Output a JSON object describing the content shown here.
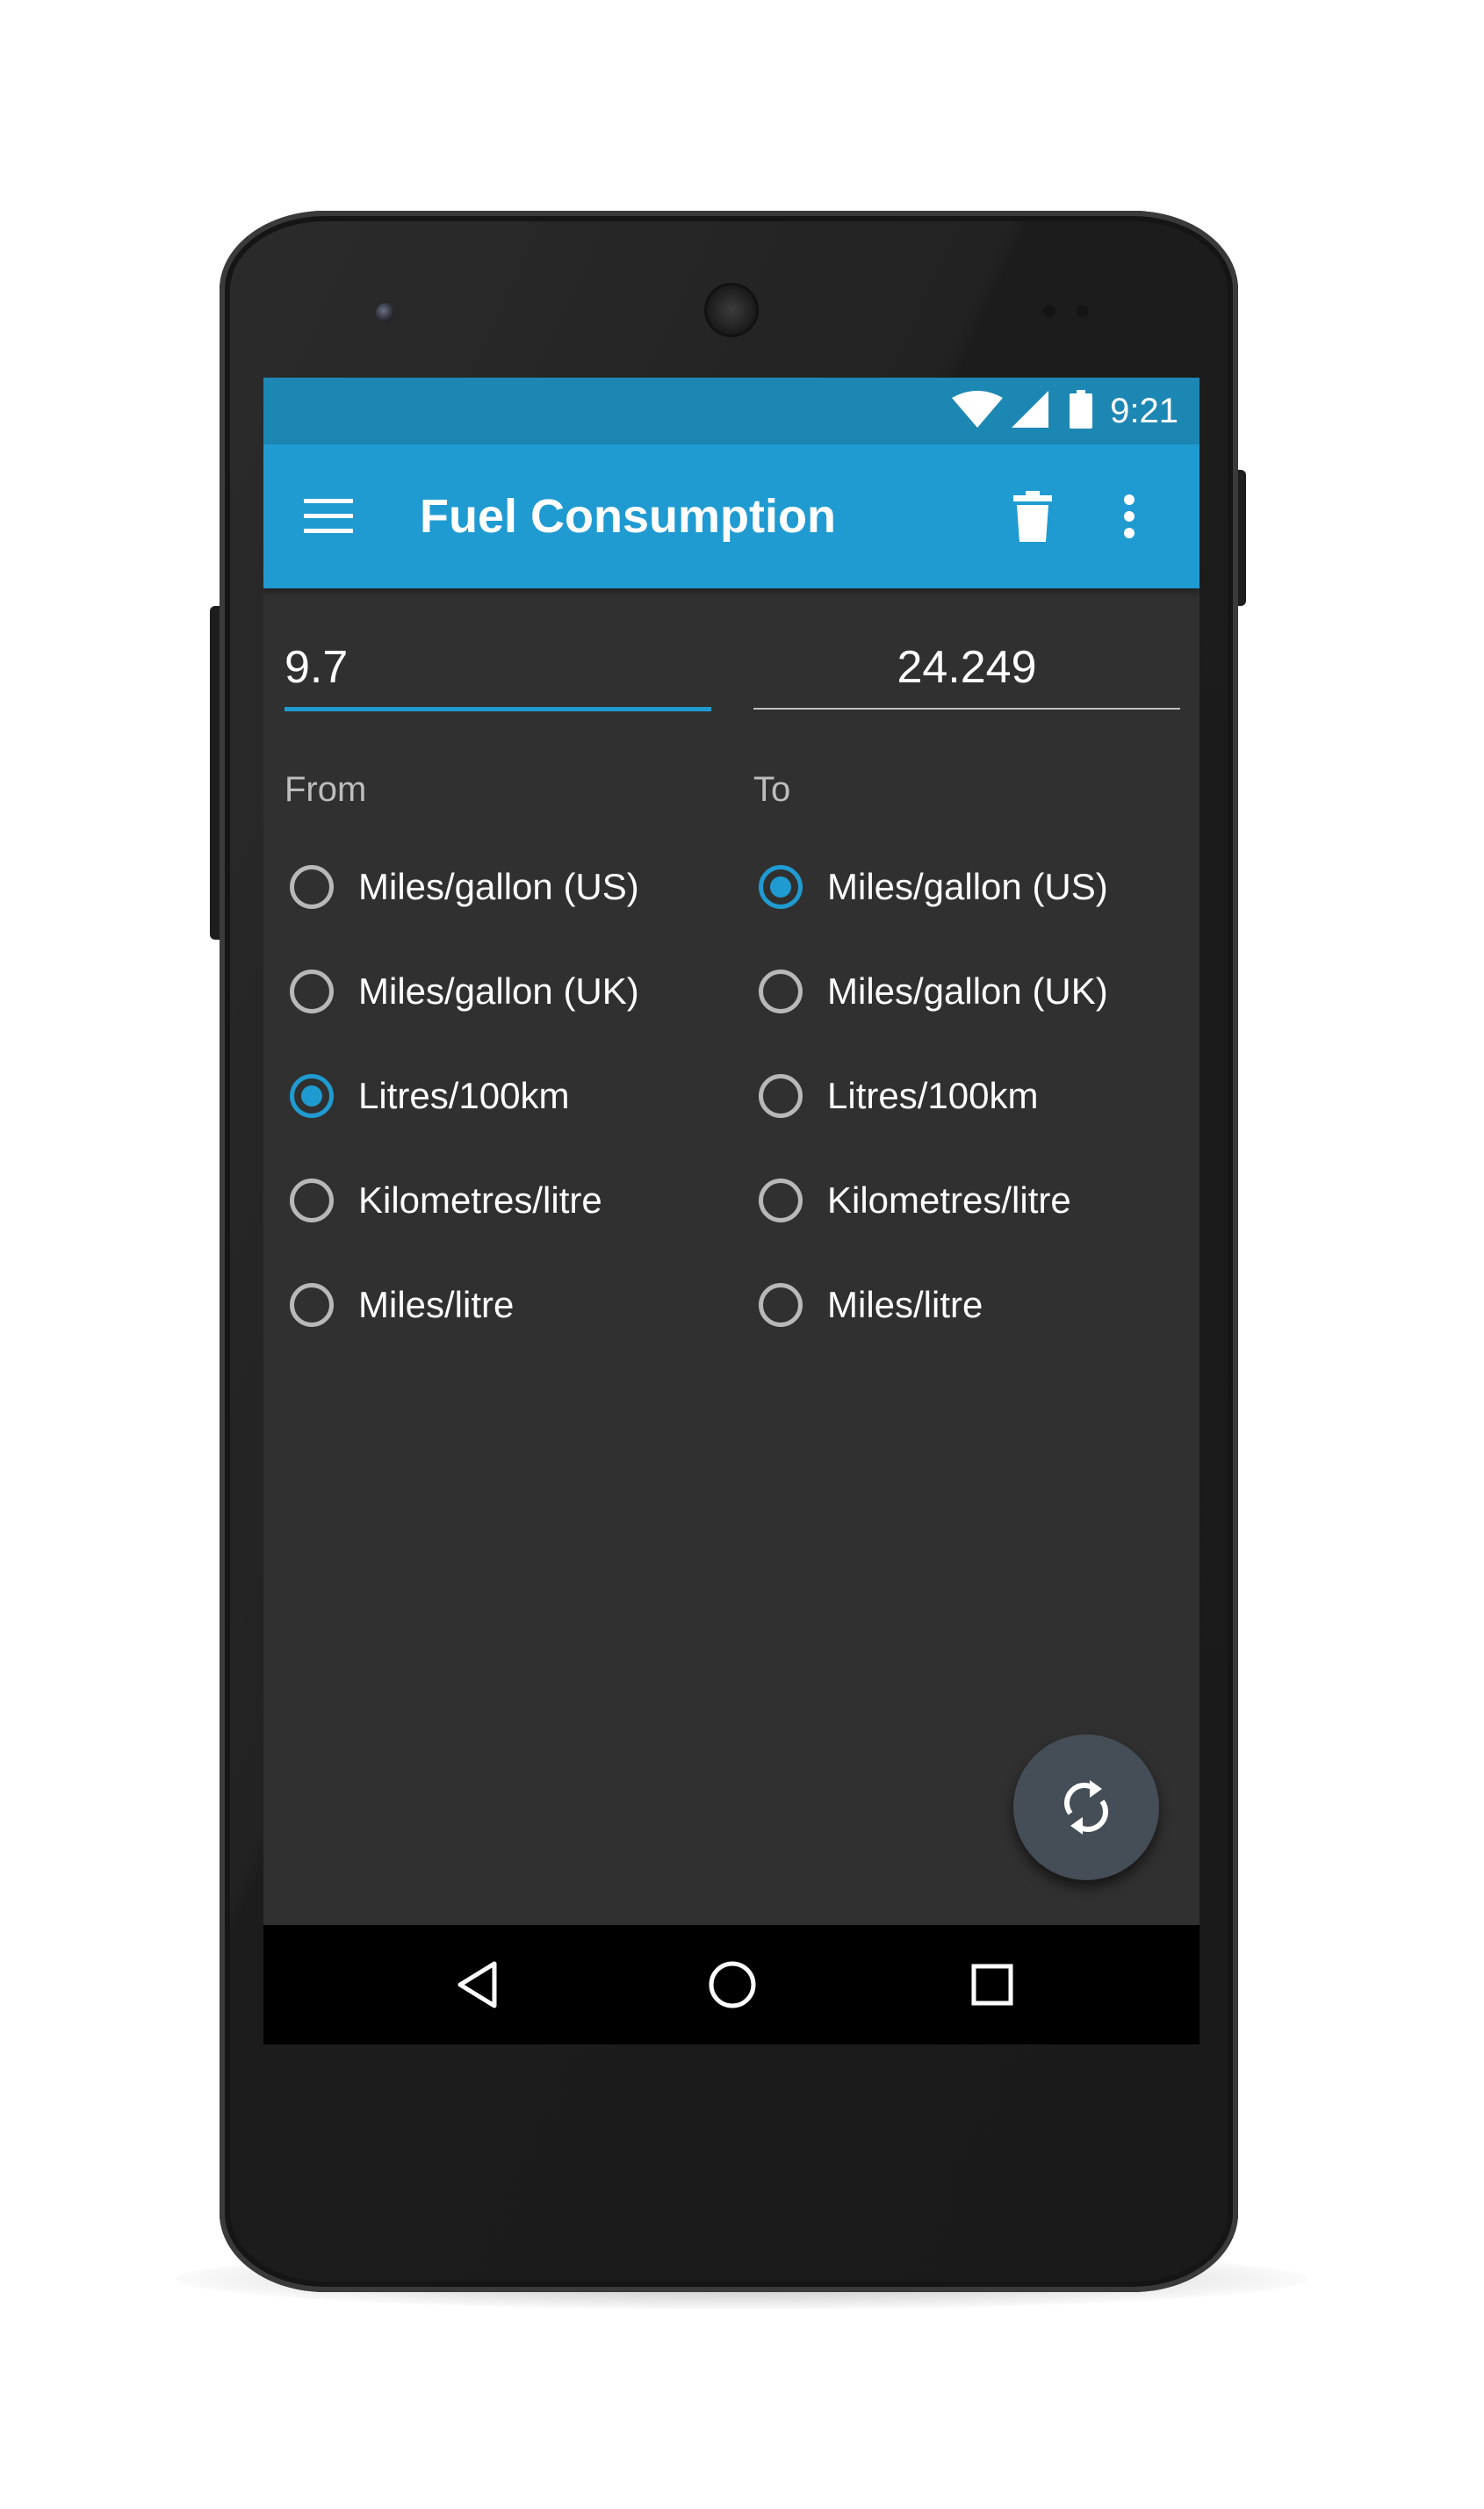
{
  "status_bar": {
    "time": "9:21",
    "icons": [
      "wifi-icon",
      "cell-signal-icon",
      "battery-icon"
    ]
  },
  "app_bar": {
    "title": "Fuel Consumption",
    "menu_icon": "menu-icon",
    "delete_icon": "delete-icon",
    "overflow_icon": "more-vert-icon"
  },
  "from": {
    "value": "9.7",
    "label": "From",
    "options": [
      {
        "label": "Miles/gallon (US)",
        "checked": false
      },
      {
        "label": "Miles/gallon (UK)",
        "checked": false
      },
      {
        "label": "Litres/100km",
        "checked": true
      },
      {
        "label": "Kilometres/litre",
        "checked": false
      },
      {
        "label": "Miles/litre",
        "checked": false
      }
    ]
  },
  "to": {
    "value": "24.249",
    "label": "To",
    "options": [
      {
        "label": "Miles/gallon (US)",
        "checked": true
      },
      {
        "label": "Miles/gallon (UK)",
        "checked": false
      },
      {
        "label": "Litres/100km",
        "checked": false
      },
      {
        "label": "Kilometres/litre",
        "checked": false
      },
      {
        "label": "Miles/litre",
        "checked": false
      }
    ]
  },
  "fab": {
    "icon": "swap-sync-icon"
  },
  "nav_bar": {
    "back_icon": "back-triangle-icon",
    "home_icon": "home-circle-icon",
    "recents_icon": "recents-square-icon"
  },
  "colors": {
    "accent": "#1f9bd1",
    "status_bar": "#1d87b3",
    "background": "#303030",
    "fab": "#454d56"
  }
}
